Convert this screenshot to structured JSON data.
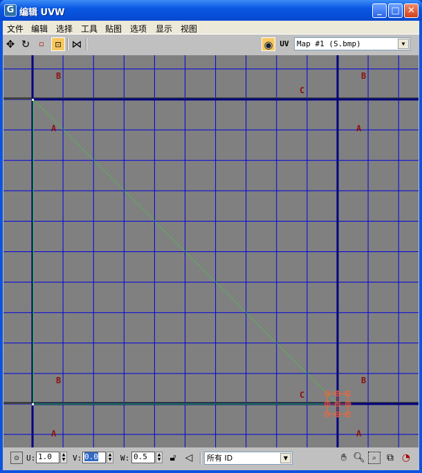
{
  "window": {
    "title": "编辑 UVW",
    "app_icon": "G",
    "minimize": "_",
    "maximize": "□",
    "close": "✕"
  },
  "menu": [
    "文件",
    "编辑",
    "选择",
    "工具",
    "贴图",
    "选项",
    "显示",
    "视图"
  ],
  "toolbar": {
    "uv_label": "UV",
    "map_select": "Map #1  (S.bmp)"
  },
  "viewport": {
    "labels": [
      {
        "text": "B",
        "col": "a",
        "row": "top"
      },
      {
        "text": "C",
        "col": "c",
        "row": "top"
      },
      {
        "text": "B",
        "col": "b",
        "row": "top"
      },
      {
        "text": "A",
        "col": "a",
        "row": "mid"
      },
      {
        "text": "A",
        "col": "b",
        "row": "mid"
      },
      {
        "text": "B",
        "col": "a",
        "row": "low"
      },
      {
        "text": "C",
        "col": "c",
        "row": "low"
      },
      {
        "text": "B",
        "col": "b",
        "row": "low"
      },
      {
        "text": "A",
        "col": "a",
        "row": "bot"
      },
      {
        "text": "A",
        "col": "b",
        "row": "bot"
      }
    ],
    "colors": {
      "background": "#808080",
      "grid": "#0000e0",
      "border": "#000080",
      "selection": "#ff6030",
      "edge": "#30e030"
    }
  },
  "bottom": {
    "u_label": "U:",
    "u_value": "1.0",
    "v_label": "V:",
    "v_value": "0.0",
    "w_label": "W:",
    "w_value": "0.5",
    "id_select": "所有 ID"
  }
}
